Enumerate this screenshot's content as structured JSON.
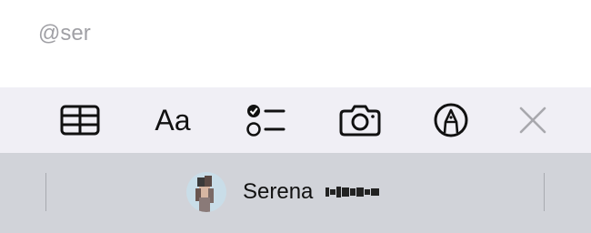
{
  "editor": {
    "typed_text": "@ser"
  },
  "toolbar": {
    "tools": [
      {
        "name": "table-icon"
      },
      {
        "name": "format-text-icon",
        "label": "Aa"
      },
      {
        "name": "checklist-icon"
      },
      {
        "name": "camera-icon"
      },
      {
        "name": "markup-pen-icon"
      },
      {
        "name": "close-icon"
      }
    ]
  },
  "mention_suggestions": {
    "items": [
      {
        "first_name": "Serena",
        "last_name_redacted": true
      }
    ]
  },
  "colors": {
    "toolbar_bg": "#f0eff5",
    "suggestion_bar_bg": "#d1d3d9",
    "placeholder_text": "#a0a0a5",
    "icon": "#111111",
    "close_icon": "#a8a8ad"
  }
}
